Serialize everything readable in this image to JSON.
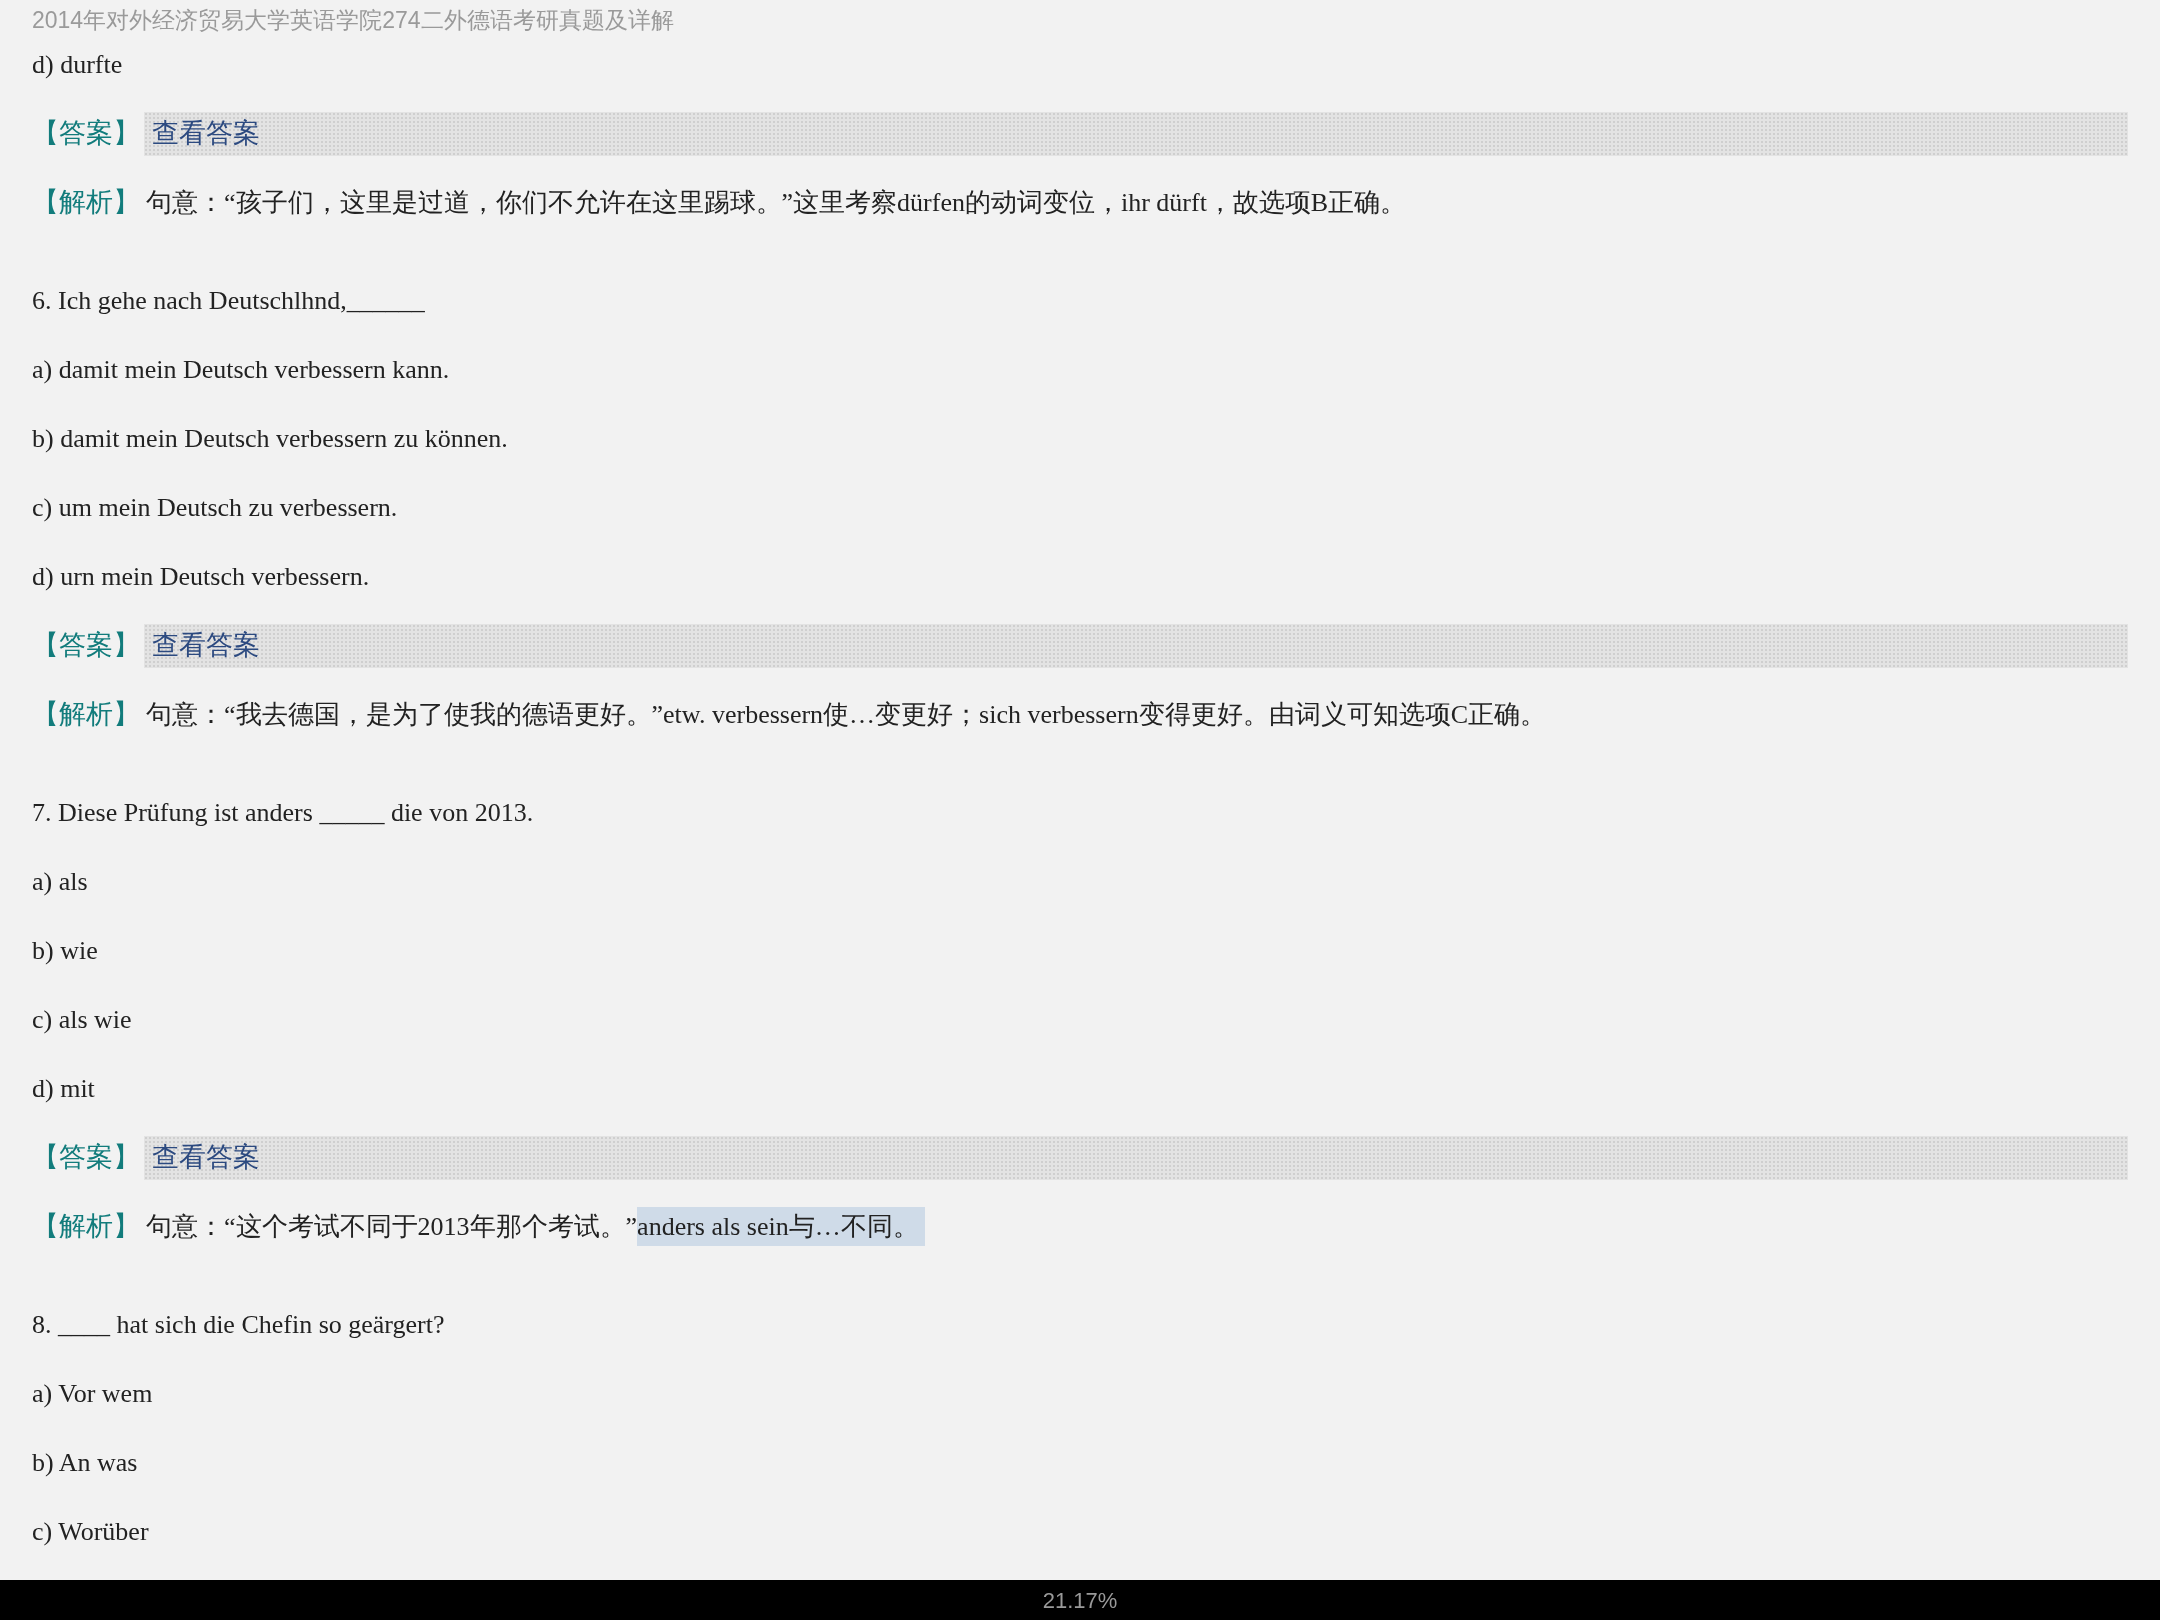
{
  "header": {
    "title": "2014年对外经济贸易大学英语学院274二外德语考研真题及详解"
  },
  "blocks": [
    {
      "kind": "line",
      "text": "d) durfte"
    },
    {
      "kind": "answer",
      "label": "【答案】",
      "button": "查看答案"
    },
    {
      "kind": "analysis",
      "label": "【解析】",
      "text": "句意：“孩子们，这里是过道，你们不允许在这里踢球。”这里考察dürfen的动词变位，ihr dürft，故选项B正确。"
    },
    {
      "kind": "line",
      "text": "6. Ich gehe nach Deutschlhnd,______"
    },
    {
      "kind": "line",
      "text": "a) damit mein Deutsch verbessern kann."
    },
    {
      "kind": "line",
      "text": "b) damit mein Deutsch verbessern zu können."
    },
    {
      "kind": "line",
      "text": "c) um mein Deutsch zu verbessern."
    },
    {
      "kind": "line",
      "text": "d) urn mein Deutsch verbessern."
    },
    {
      "kind": "answer",
      "label": "【答案】",
      "button": "查看答案"
    },
    {
      "kind": "analysis",
      "label": "【解析】",
      "text": "句意：“我去德国，是为了使我的德语更好。”etw. verbessern使…变更好；sich verbessern变得更好。由词义可知选项C正确。"
    },
    {
      "kind": "line",
      "text": "7. Diese Prüfung ist anders _____ die von 2013."
    },
    {
      "kind": "line",
      "text": "a) als"
    },
    {
      "kind": "line",
      "text": "b) wie"
    },
    {
      "kind": "line",
      "text": "c) als wie"
    },
    {
      "kind": "line",
      "text": "d) mit"
    },
    {
      "kind": "answer",
      "label": "【答案】",
      "button": "查看答案"
    },
    {
      "kind": "analysis",
      "label": "【解析】",
      "text": "句意：“这个考试不同于2013年那个考试。”",
      "selection": "anders als sein与…不同。"
    },
    {
      "kind": "line",
      "text": "8. ____ hat sich die Chefin so geärgert?"
    },
    {
      "kind": "line",
      "text": "a) Vor wem"
    },
    {
      "kind": "line",
      "text": "b) An was"
    },
    {
      "kind": "line",
      "text": "c) Worüber"
    }
  ],
  "status_bar": {
    "progress": "21.17%"
  }
}
